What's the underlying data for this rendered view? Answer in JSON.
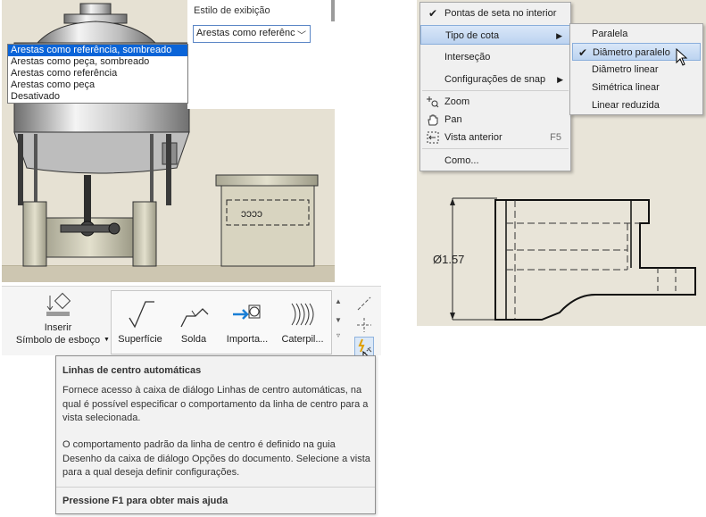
{
  "display_style": {
    "label": "Estilo de exibição",
    "selected_value": "Arestas como referênc",
    "options": [
      "Arestas como referência, sombreado",
      "Arestas como peça, sombreado",
      "Arestas como referência",
      "Arestas como peça",
      "Desativado"
    ],
    "highlighted_index": 0
  },
  "context_menu": {
    "items": [
      {
        "label": "Pontas de seta no interior",
        "checked": true
      },
      {
        "label": "Tipo de cota",
        "submenu": true
      },
      {
        "label": "Interseção"
      },
      {
        "label": "Configurações de snap",
        "submenu": true
      },
      {
        "label": "Zoom",
        "icon": "zoom-icon"
      },
      {
        "label": "Pan",
        "icon": "pan-hand-icon"
      },
      {
        "label": "Vista anterior",
        "icon": "previous-view-icon",
        "shortcut": "F5"
      },
      {
        "label": "Como..."
      }
    ]
  },
  "dimension_type_submenu": {
    "items": [
      {
        "label": "Paralela"
      },
      {
        "label": "Diâmetro paralelo",
        "checked": true
      },
      {
        "label": "Diâmetro linear"
      },
      {
        "label": "Simétrica linear"
      },
      {
        "label": "Linear reduzida"
      }
    ]
  },
  "drawing": {
    "dimension_text": "Ø1.57"
  },
  "ribbon": {
    "insert_sketch_symbol": {
      "line1": "Inserir",
      "line2": "Símbolo de esboço"
    },
    "gallery": [
      {
        "label": "Superfície",
        "icon": "surface-symbol-icon"
      },
      {
        "label": "Solda",
        "icon": "weld-symbol-icon"
      },
      {
        "label": "Importa...",
        "icon": "import-symbol-icon"
      },
      {
        "label": "Caterpil...",
        "icon": "caterpillar-icon"
      }
    ]
  },
  "tooltip": {
    "title": "Linhas de centro automáticas",
    "paragraph1": "Fornece acesso à caixa de diálogo Linhas de centro automáticas, na qual é possível especificar o comportamento da linha de centro para a vista selecionada.",
    "paragraph2": "O comportamento padrão da linha de centro é definido na guia Desenho da caixa de diálogo Opções do documento. Selecione a vista para a qual deseja definir configurações.",
    "footer": "Pressione F1 para obter mais ajuda"
  },
  "colors": {
    "selection_blue": "#0a64d8",
    "menu_highlight": "#c5daf3",
    "model_background": "#e6e1d3"
  }
}
